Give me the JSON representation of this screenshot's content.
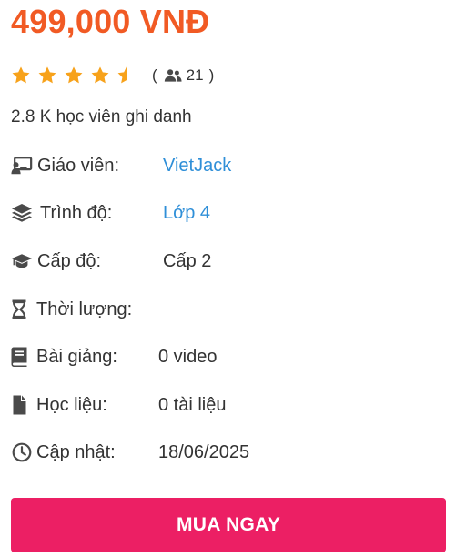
{
  "price": "499,000 VNĐ",
  "rating": {
    "stars_value": 4.5,
    "stars_max": 5,
    "star_color": "#f7a21b",
    "paren_open": "(",
    "paren_close": ")",
    "count": "21",
    "count_icon": "users-icon"
  },
  "enrolled": "2.8 K học viên ghi danh",
  "details": {
    "teacher": {
      "icon": "teacher-board-icon",
      "label": "Giáo viên:",
      "value": "VietJack"
    },
    "level": {
      "icon": "layers-icon",
      "label": "Trình độ:",
      "value": "Lớp 4"
    },
    "grade": {
      "icon": "graduation-cap-icon",
      "label": "Cấp độ:",
      "value": "Cấp 2"
    },
    "duration": {
      "icon": "hourglass-icon",
      "label": "Thời lượng:",
      "value": ""
    },
    "lessons": {
      "icon": "book-icon",
      "label": "Bài giảng:",
      "value": "0 video"
    },
    "materials": {
      "icon": "file-icon",
      "label": "Học liệu:",
      "value": "0 tài liệu"
    },
    "updated": {
      "icon": "clock-icon",
      "label": "Cập nhật:",
      "value": "18/06/2025"
    }
  },
  "buy_button": {
    "label": "MUA NGAY"
  },
  "colors": {
    "price": "#f15a24",
    "link": "#2f8fd8",
    "button": "#ec1f64",
    "text": "#333333",
    "icon": "#4a4a4a"
  }
}
